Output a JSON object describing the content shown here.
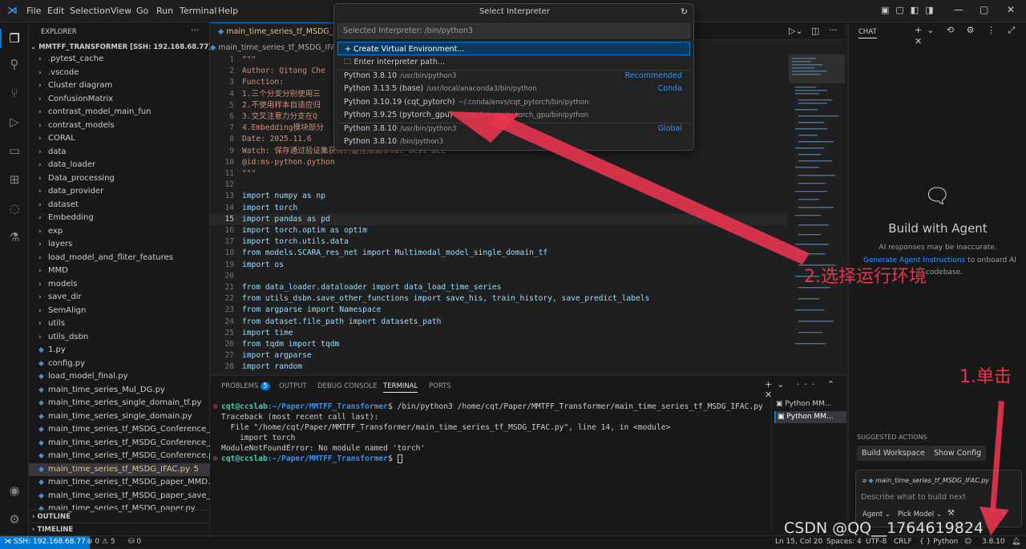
{
  "titlebar": {
    "menus": [
      "File",
      "Edit",
      "Selection",
      "View",
      "Go",
      "Run",
      "Terminal",
      "Help"
    ]
  },
  "explorer": {
    "header": "EXPLORER",
    "root": "MMTFF_TRANSFORMER [SSH: 192.168.68.77]",
    "folders": [
      ".pytest_cache",
      ".vscode",
      "Cluster diagram",
      "ConfusionMatrix",
      "contrast_model_main_fun",
      "contrast_models",
      "CORAL",
      "data",
      "data_loader",
      "Data_processing",
      "data_provider",
      "dataset",
      "Embedding",
      "exp",
      "layers",
      "load_model_and_fliter_features",
      "MMD",
      "models",
      "save_dir",
      "SemAlign",
      "utils",
      "utils_dsbn"
    ],
    "files": [
      "1.py",
      "config.py",
      "load_model_final.py",
      "main_time_series_Mul_DG.py",
      "main_time_series_single_domain_tf.py",
      "main_time_series_single_domain.py",
      "main_time_series_tf_MSDG_Conference_WT_...",
      "main_time_series_tf_MSDG_Conference_WT.py",
      "main_time_series_tf_MSDG_Conference.py",
      "main_time_series_tf_MSDG_IFAC.py",
      "main_time_series_tf_MSDG_paper_MMD.py",
      "main_time_series_tf_MSDG_paper_save_best...",
      "main_time_series_tf_MSDG_paper.py"
    ],
    "active_file_badge": "5",
    "outline": "OUTLINE",
    "timeline": "TIMELINE"
  },
  "editor": {
    "tab_label": "main_time_series_tf_MSDG_IFAC",
    "breadcrumb": "main_time_series_tf_MSDG_IFA",
    "lines": [
      {
        "n": "1",
        "t": "\"\"\""
      },
      {
        "n": "",
        "t": "Author: Qitong Che"
      },
      {
        "n": "",
        "t": "Function:"
      },
      {
        "n": "",
        "t": "1.三个分支分别使用三"
      },
      {
        "n": "",
        "t": "2.不使用样本自适应归"
      },
      {
        "n": "",
        "t": "3.交叉注意力分支在Q"
      },
      {
        "n": "",
        "t": "4.Embedding模块部分"
      },
      {
        "n": "",
        "t": "Date: 2025.11.6"
      },
      {
        "n": "",
        "t": "Watch: 保存通过验证集获得的最佳准确率val_best_acc"
      },
      {
        "n": "",
        "t": "@id:ms-python.python"
      },
      {
        "n": "",
        "t": "\"\"\""
      },
      {
        "n": "",
        "t": ""
      },
      {
        "n": "13",
        "t": "import numpy as np"
      },
      {
        "n": "14",
        "t": "import torch"
      },
      {
        "n": "15",
        "t": "import pandas as pd"
      },
      {
        "n": "16",
        "t": "import torch.optim as optim"
      },
      {
        "n": "17",
        "t": "import torch.utils.data"
      },
      {
        "n": "18",
        "t": "from models.SCARA_res_net import Multimodal_model_single_domain_tf"
      },
      {
        "n": "19",
        "t": "import os"
      },
      {
        "n": "20",
        "t": ""
      },
      {
        "n": "21",
        "t": "from data_loader.dataloader import data_load_time_series"
      },
      {
        "n": "22",
        "t": "from utils_dsbn.save_other_functions import save_his, train_history, save_predict_labels"
      },
      {
        "n": "23",
        "t": "from argparse import Namespace"
      },
      {
        "n": "24",
        "t": "from dataset.file_path import datasets_path"
      },
      {
        "n": "25",
        "t": "import time"
      },
      {
        "n": "26",
        "t": "from tqdm import tqdm"
      },
      {
        "n": "27",
        "t": "import argparse"
      },
      {
        "n": "28",
        "t": "import random"
      }
    ]
  },
  "quickpick": {
    "title": "Select Interpreter",
    "placeholder": "Selected Interpreter: /bin/python3",
    "items": [
      {
        "label": "+ Create Virtual Environment...",
        "desc": "",
        "tag": ""
      },
      {
        "label": "Enter interpreter path...",
        "desc": "",
        "tag": ""
      },
      {
        "label": "Python 3.8.10",
        "desc": "/usr/bin/python3",
        "tag": "Recommended"
      },
      {
        "label": "Python 3.13.5 (base)",
        "desc": "/usr/local/anaconda3/bin/python",
        "tag": "Conda"
      },
      {
        "label": "Python 3.10.19 (cqt_pytorch)",
        "desc": "~/.conda/envs/cqt_pytorch/bin/python",
        "tag": ""
      },
      {
        "label": "Python 3.9.25 (pytorch_gpu)",
        "desc": "~/.conda/envs/pytorch_gpu/bin/python",
        "tag": ""
      },
      {
        "label": "Python 3.8.10",
        "desc": "/usr/bin/python3",
        "tag": "Global"
      },
      {
        "label": "Python 3.8.10",
        "desc": "/bin/python3",
        "tag": ""
      }
    ]
  },
  "panel": {
    "tabs": [
      "PROBLEMS",
      "OUTPUT",
      "DEBUG CONSOLE",
      "TERMINAL",
      "PORTS"
    ],
    "problems_count": "5",
    "terminal_lines": [
      {
        "prompt": "cqt@ccslab",
        "path": ":~/Paper/MMTFF_Transformer",
        "cmd": "$ /bin/python3 /home/cqt/Paper/MMTFF_Transformer/main_time_series_tf_MSDG_IFAC.py"
      },
      {
        "text": "Traceback (most recent call last):"
      },
      {
        "text": "  File \"/home/cqt/Paper/MMTFF_Transformer/main_time_series_tf_MSDG_IFAC.py\", line 14, in <module>"
      },
      {
        "text": "    import torch"
      },
      {
        "text": "ModuleNotFoundError: No module named 'torch'"
      },
      {
        "prompt": "cqt@ccslab",
        "path": ":~/Paper/MMTFF_Transformer",
        "cmd": "$ "
      }
    ],
    "terminal_list": [
      "Python MM...",
      "Python MM..."
    ]
  },
  "chat": {
    "header": "CHAT",
    "title": "Build with Agent",
    "subtitle": "AI responses may be inaccurate.",
    "link": "Generate Agent Instructions",
    "link_tail": "to onboard AI",
    "link_tail2": "codebase.",
    "suggested": "SUGGESTED ACTIONS",
    "btn1": "Build Workspace",
    "btn2": "Show Config",
    "context_file": "main_time_series_tf_MSDG_IFAC.py",
    "input_placeholder": "Describe what to build next",
    "agent": "Agent",
    "pick_model": "Pick Model"
  },
  "statusbar": {
    "remote": "SSH: 192.168.68.77",
    "errors": "0",
    "warnings": "5",
    "ports": "0",
    "position": "Ln 15, Col 20",
    "spaces": "Spaces: 4",
    "encoding": "UTF-8",
    "eol": "CRLF",
    "language": "Python",
    "interpreter": "3.8.10"
  },
  "annotations": {
    "step1": "1.单击",
    "step2": "2.选择运行环境",
    "watermark": "CSDN @QQ__1764619824"
  },
  "colors": {
    "annotation": "#e8344f",
    "accent": "#0078d4",
    "link": "#3794ff"
  }
}
